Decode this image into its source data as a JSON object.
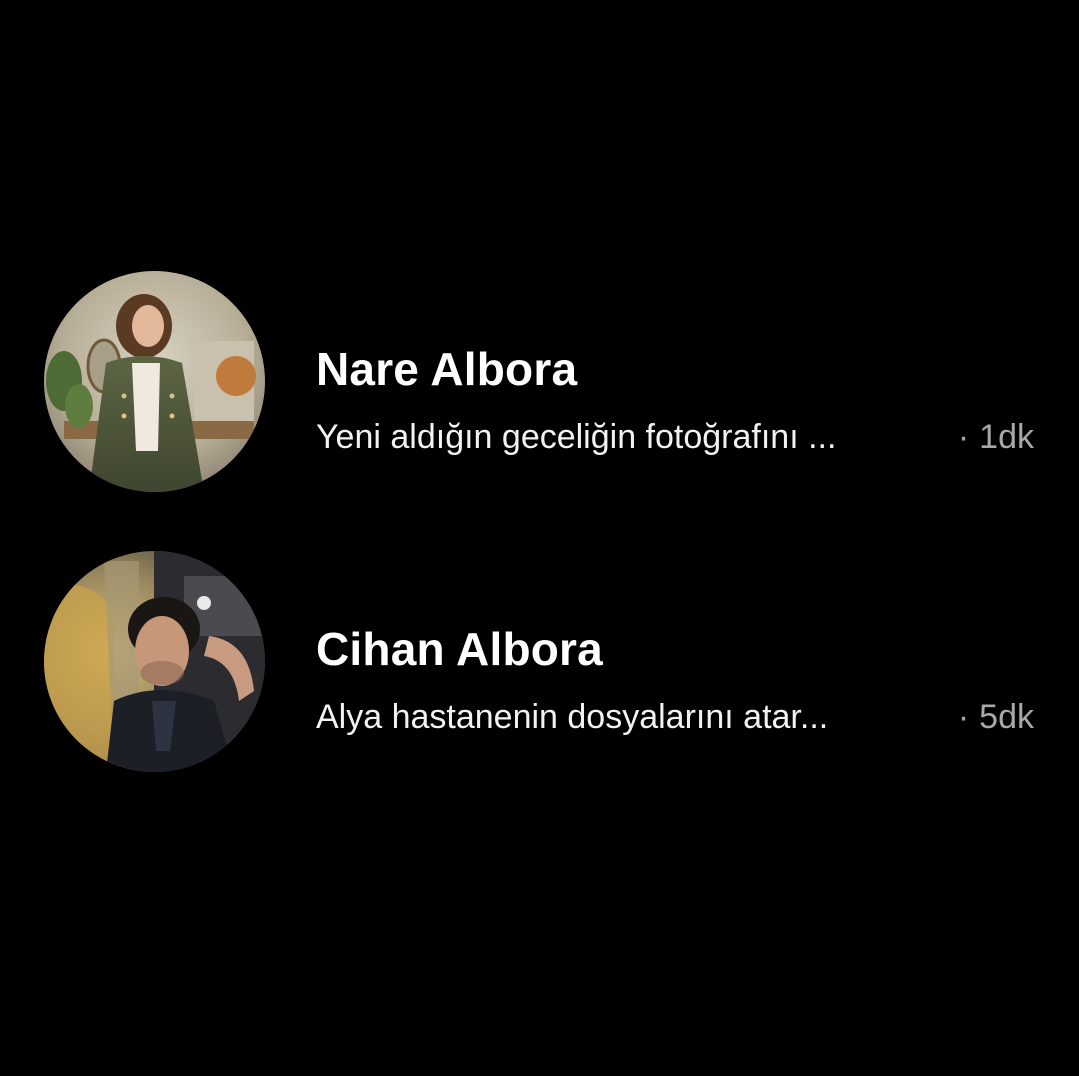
{
  "conversations": [
    {
      "name": "Nare Albora",
      "preview": "Yeni aldığın geceliğin fotoğrafını ...",
      "separator": "·",
      "time": "1dk"
    },
    {
      "name": "Cihan Albora",
      "preview": "Alya hastanenin dosyalarını atar...",
      "separator": "·",
      "time": "5dk"
    }
  ],
  "colors": {
    "background": "#000000",
    "name_text": "#ffffff",
    "preview_text": "#f2f2f2",
    "time_text": "#a8a8a8"
  }
}
